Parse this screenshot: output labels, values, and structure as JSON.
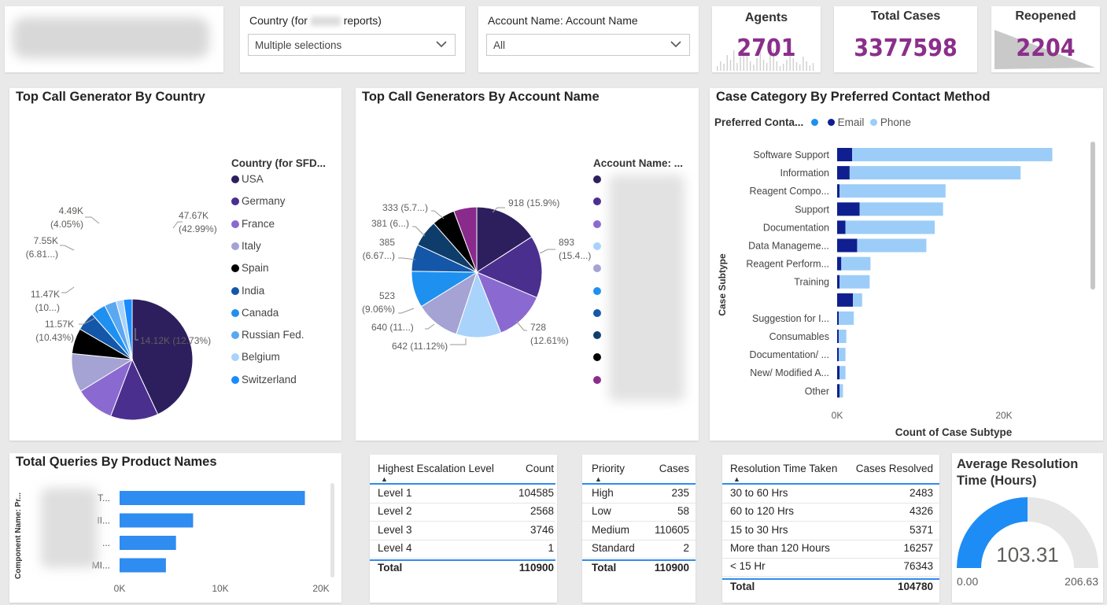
{
  "slicers": {
    "country_label_prefix": "Country (for",
    "country_label_suffix": "reports)",
    "country_value": "Multiple selections",
    "account_label": "Account Name: Account Name",
    "account_value": "All"
  },
  "kpis": {
    "agents_label": "Agents",
    "agents_value": "2701",
    "total_cases_label": "Total Cases",
    "total_cases_value": "3377598",
    "reopened_label": "Reopened",
    "reopened_value": "2204"
  },
  "colors": {
    "navy": "#2d1f5e",
    "indigo": "#4b2f8f",
    "violet": "#8a6ad0",
    "lavender": "#a5a2d4",
    "black": "#000000",
    "darkblue": "#1457a8",
    "blue": "#1e90f0",
    "lightblue": "#5aa8f0",
    "paleblue": "#a9d3fb",
    "skyblue": "#1a8cff",
    "email": "#0f1f8f",
    "phone": "#9ccdf8",
    "bar": "#2f8cf0",
    "gauge": "#1e8cf5",
    "kpi": "#8b2f8b"
  },
  "chart_data": [
    {
      "type": "pie",
      "title": "Top Call Generator By Country",
      "legend_title": "Country (for SFD...",
      "legend_position": "right",
      "categories": [
        "USA",
        "Germany",
        "France",
        "Italy",
        "Spain",
        "India",
        "Canada",
        "Russian Fed.",
        "Belgium",
        "Switzerland"
      ],
      "values": [
        47670,
        14120,
        11570,
        11470,
        7550,
        5600,
        4490,
        3500,
        2200,
        2600
      ],
      "data_labels": [
        {
          "value": "47.67K",
          "pct": "(42.99%)"
        },
        {
          "value": "14.12K (12.73%)",
          "pct": ""
        },
        {
          "value": "11.57K",
          "pct": "(10.43%)"
        },
        {
          "value": "11.47K",
          "pct": "(10...)"
        },
        {
          "value": "7.55K",
          "pct": "(6.81...)"
        },
        {
          "value": "4.49K",
          "pct": "(4.05%)"
        }
      ]
    },
    {
      "type": "pie",
      "title": "Top Call Generators By Account Name",
      "legend_title": "Account Name: ...",
      "legend_position": "right",
      "values": [
        918,
        893,
        728,
        642,
        640,
        523,
        385,
        381,
        333,
        330
      ],
      "data_labels": [
        {
          "value": "918 (15.9%)",
          "pct": ""
        },
        {
          "value": "893",
          "pct": "(15.4...)"
        },
        {
          "value": "728",
          "pct": "(12.61%)"
        },
        {
          "value": "642 (11.12%)",
          "pct": ""
        },
        {
          "value": "640 (11...)",
          "pct": ""
        },
        {
          "value": "523",
          "pct": "(9.06%)"
        },
        {
          "value": "385",
          "pct": "(6.67...)"
        },
        {
          "value": "381 (6...)",
          "pct": ""
        },
        {
          "value": "333 (5.7...)",
          "pct": ""
        }
      ]
    },
    {
      "type": "bar",
      "orientation": "horizontal",
      "stacked": true,
      "title": "Case Category By Preferred Contact Method",
      "legend_title": "Preferred Conta...",
      "legend_position": "top-left",
      "legend_items": [
        "Email",
        "Phone"
      ],
      "categories": [
        "Software Support",
        "Information",
        "Reagent Compo...",
        "Support",
        "Documentation",
        "Data Manageme...",
        "Reagent Perform...",
        "Training",
        "",
        "Suggestion for I...",
        "Consumables",
        "Documentation/ ...",
        "New/ Modified A...",
        "Other"
      ],
      "series": [
        {
          "name": "Email",
          "values": [
            1800,
            1500,
            300,
            2700,
            1000,
            2400,
            500,
            300,
            1900,
            200,
            200,
            200,
            300,
            300
          ]
        },
        {
          "name": "Phone",
          "values": [
            24000,
            20500,
            12700,
            10000,
            10700,
            8300,
            3500,
            3600,
            1100,
            1800,
            900,
            800,
            700,
            400
          ]
        }
      ],
      "xlabel": "Count of Case Subtype",
      "ylabel": "Case Subtype",
      "xlim": [
        0,
        30000
      ],
      "xticks": [
        "0K",
        "20K"
      ]
    },
    {
      "type": "bar",
      "orientation": "horizontal",
      "title": "Total Queries By Product Names",
      "ylabel": "Component Name: Pr...",
      "categories": [
        "T...",
        "II...",
        "...",
        "MI..."
      ],
      "values": [
        18400,
        7300,
        5600,
        4600
      ],
      "xlim": [
        0,
        20000
      ],
      "xticks": [
        "0K",
        "10K",
        "20K"
      ]
    },
    {
      "type": "table",
      "columns": [
        "Highest Escalation Level",
        "Count"
      ],
      "rows": [
        [
          "Level 1",
          "104585"
        ],
        [
          "Level 2",
          "2568"
        ],
        [
          "Level 3",
          "3746"
        ],
        [
          "Level 4",
          "1"
        ]
      ],
      "total": [
        "Total",
        "110900"
      ]
    },
    {
      "type": "table",
      "columns": [
        "Priority",
        "Cases"
      ],
      "rows": [
        [
          "High",
          "235"
        ],
        [
          "Low",
          "58"
        ],
        [
          "Medium",
          "110605"
        ],
        [
          "Standard",
          "2"
        ]
      ],
      "total": [
        "Total",
        "110900"
      ]
    },
    {
      "type": "table",
      "columns": [
        "Resolution Time Taken",
        "Cases Resolved"
      ],
      "rows": [
        [
          "30 to 60 Hrs",
          "2483"
        ],
        [
          "60 to 120 Hrs",
          "4326"
        ],
        [
          "15 to 30 Hrs",
          "5371"
        ],
        [
          "More than 120 Hours",
          "16257"
        ],
        [
          "< 15 Hr",
          "76343"
        ]
      ],
      "total": [
        "Total",
        "104780"
      ]
    },
    {
      "type": "gauge",
      "title": "Average Resolution Time (Hours)",
      "value": 103.31,
      "min": 0,
      "max": 206.63,
      "value_label": "103.31",
      "min_label": "0.00",
      "max_label": "206.63"
    }
  ]
}
